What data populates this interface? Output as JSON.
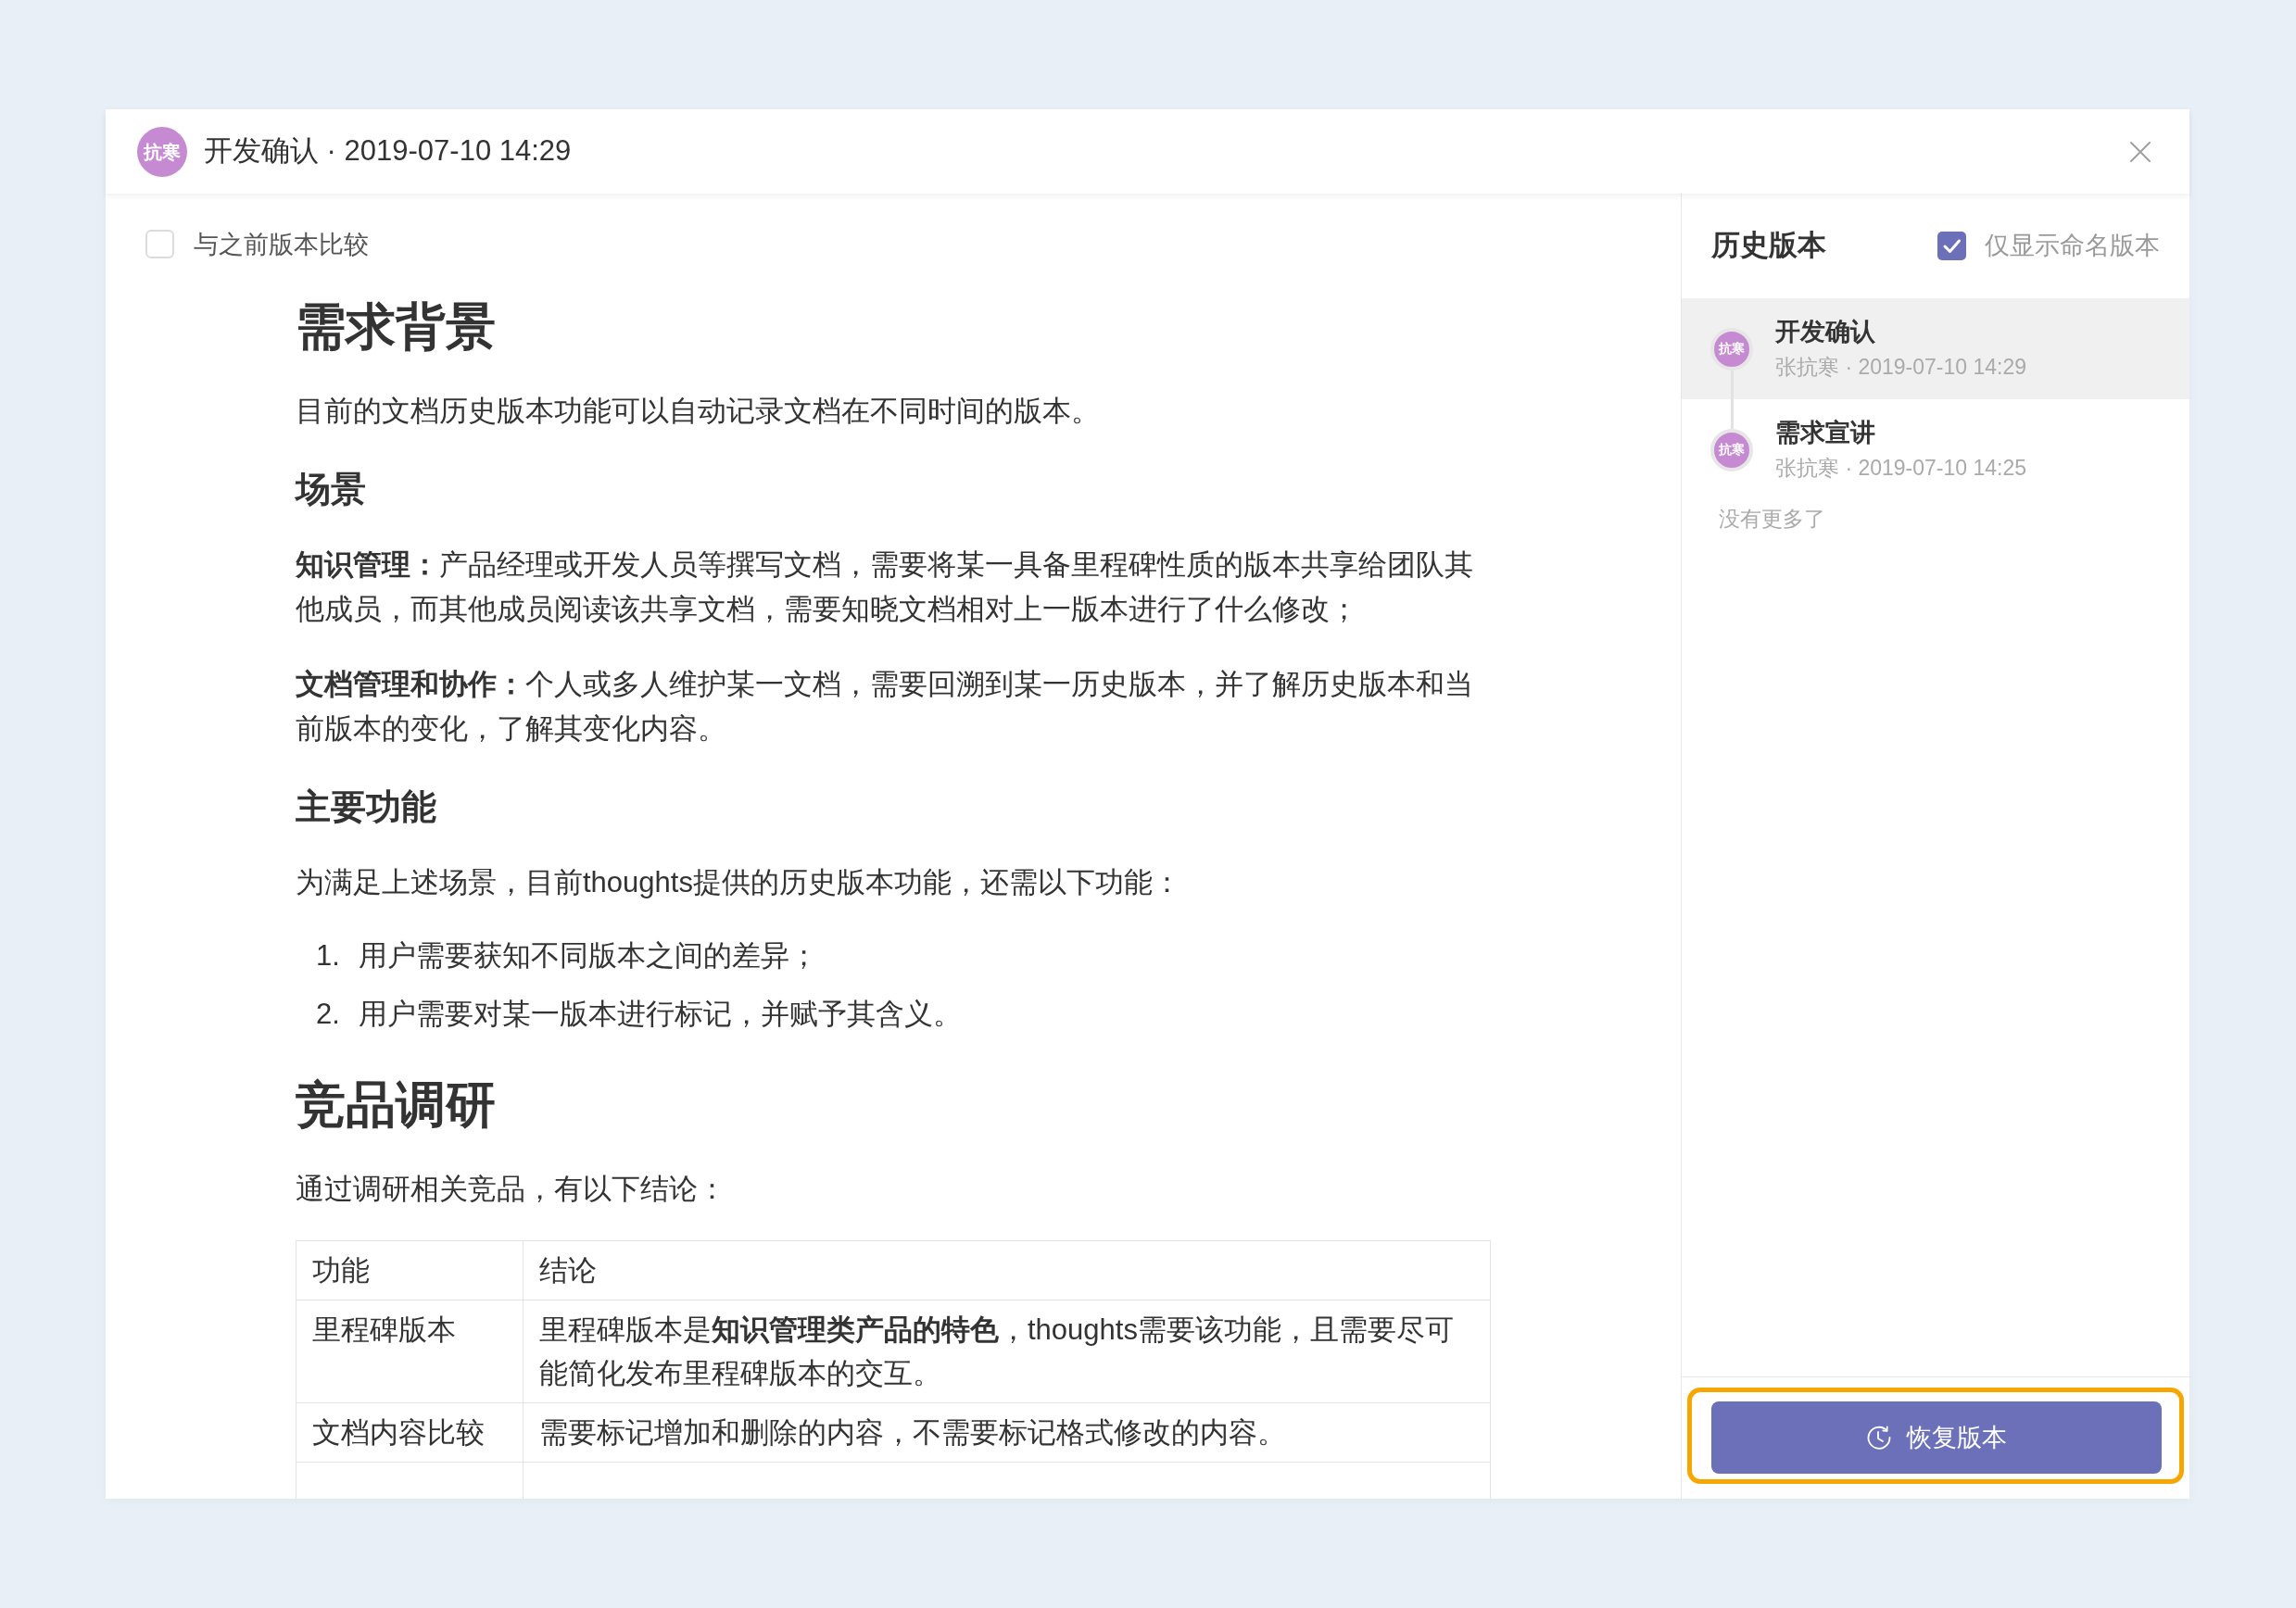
{
  "dialog": {
    "avatar": "抗寒",
    "title": "开发确认 · 2019-07-10 14:29"
  },
  "compare": {
    "label": "与之前版本比较",
    "checked": false
  },
  "document": [
    {
      "kind": "h1",
      "text": "需求背景"
    },
    {
      "kind": "p",
      "text": "目前的文档历史版本功能可以自动记录文档在不同时间的版本。"
    },
    {
      "kind": "h2",
      "text": "场景"
    },
    {
      "kind": "p",
      "text": "**知识管理：**产品经理或开发人员等撰写文档，需要将某一具备里程碑性质的版本共享给团队其他成员，而其他成员阅读该共享文档，需要知晓文档相对上一版本进行了什么修改；"
    },
    {
      "kind": "p",
      "text": "**文档管理和协作：**个人或多人维护某一文档，需要回溯到某一历史版本，并了解历史版本和当前版本的变化，了解其变化内容。"
    },
    {
      "kind": "h2",
      "text": "主要功能"
    },
    {
      "kind": "p",
      "text": "为满足上述场景，目前thoughts提供的历史版本功能，还需以下功能："
    },
    {
      "kind": "ol",
      "items": [
        {
          "number": "1.",
          "text": "用户需要获知不同版本之间的差异；"
        },
        {
          "number": "2.",
          "text": "用户需要对某一版本进行标记，并赋予其含义。"
        }
      ]
    },
    {
      "kind": "h1",
      "text": "竞品调研"
    },
    {
      "kind": "p",
      "text": "通过调研相关竞品，有以下结论："
    },
    {
      "kind": "table",
      "columns": [
        "功能",
        "结论"
      ],
      "rows": [
        [
          "里程碑版本",
          "里程碑版本是**知识管理类产品的特色**，thoughts需要该功能，且需要尽可能简化发布里程碑版本的交互。"
        ],
        [
          "文档内容比较",
          "需要标记增加和删除的内容，不需要标记格式修改的内容。"
        ]
      ],
      "continues": true
    }
  ],
  "history": {
    "title": "历史版本",
    "named_only": {
      "label": "仅显示命名版本",
      "checked": true
    },
    "versions": [
      {
        "avatar": "抗寒",
        "name": "开发确认",
        "meta": "张抗寒 · 2019-07-10 14:29",
        "selected": true
      },
      {
        "avatar": "抗寒",
        "name": "需求宣讲",
        "meta": "张抗寒 · 2019-07-10 14:25",
        "selected": false
      }
    ],
    "end_note": "没有更多了",
    "restore_button": {
      "label": "恢复版本",
      "highlighted": true
    }
  }
}
